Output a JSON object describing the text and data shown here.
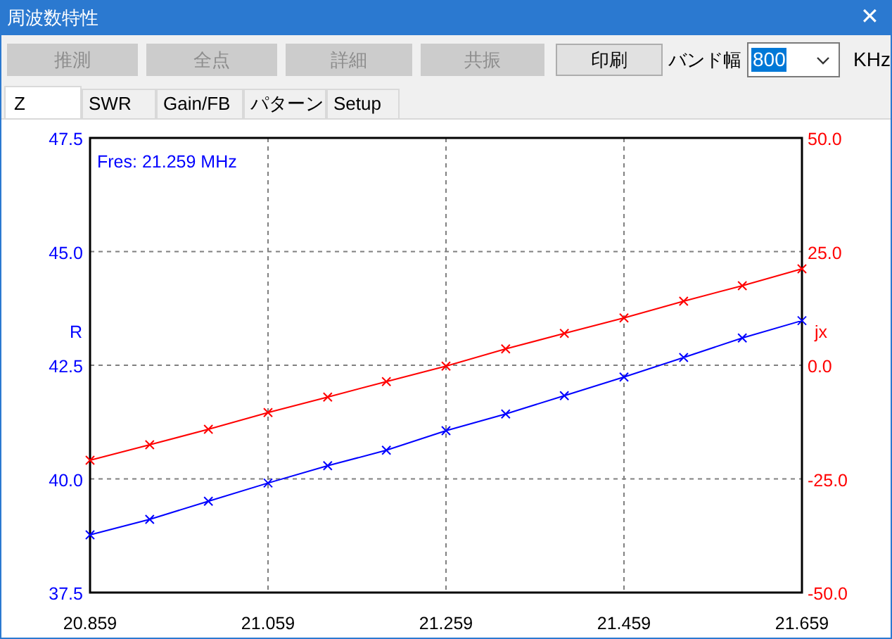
{
  "window": {
    "title": "周波数特性",
    "close": "✕"
  },
  "toolbar": {
    "buttons": [
      {
        "label": "推測",
        "disabled": true
      },
      {
        "label": "全点",
        "disabled": true
      },
      {
        "label": "詳細",
        "disabled": true
      },
      {
        "label": "共振",
        "disabled": true
      },
      {
        "label": "印刷",
        "disabled": false
      }
    ],
    "bandwidth": {
      "label": "バンド幅",
      "value": "800",
      "unit": "KHz"
    }
  },
  "tabs": [
    {
      "label": "Z",
      "selected": true
    },
    {
      "label": "SWR",
      "selected": false
    },
    {
      "label": "Gain/FB",
      "selected": false
    },
    {
      "label": "パターン",
      "selected": false
    },
    {
      "label": "Setup",
      "selected": false
    }
  ],
  "chart": {
    "chart_data": {
      "type": "line",
      "grid": true,
      "xlim": [
        20.859,
        21.659
      ],
      "ylim": [
        37.5,
        47.5
      ],
      "y2lim": [
        -50,
        50
      ],
      "xticks": [
        {
          "value": 20.859,
          "label": "20.859"
        },
        {
          "value": 21.059,
          "label": "21.059"
        },
        {
          "value": 21.259,
          "label": "21.259"
        },
        {
          "value": 21.459,
          "label": "21.459"
        },
        {
          "value": 21.659,
          "label": "21.659"
        }
      ],
      "yticks": [
        {
          "value": 37.5,
          "label": "37.5"
        },
        {
          "value": 40,
          "label": "40.0"
        },
        {
          "value": 42.5,
          "label": "42.5"
        },
        {
          "value": 45,
          "label": "45.0"
        },
        {
          "value": 47.5,
          "label": "47.5"
        }
      ],
      "y2ticks": [
        {
          "value": -50,
          "label": "-50.0"
        },
        {
          "value": -25,
          "label": "-25.0"
        },
        {
          "value": 0,
          "label": "0.0"
        },
        {
          "value": 25,
          "label": "25.0"
        },
        {
          "value": 50,
          "label": "50.0"
        }
      ],
      "x": [
        20.859,
        20.926,
        20.992,
        21.059,
        21.126,
        21.192,
        21.259,
        21.326,
        21.392,
        21.459,
        21.526,
        21.592,
        21.659
      ],
      "series": [
        {
          "name": "R",
          "color": "#0000ff",
          "marker": "x",
          "values": [
            38.77,
            39.11,
            39.51,
            39.91,
            40.29,
            40.63,
            41.06,
            41.43,
            41.83,
            42.24,
            42.67,
            43.1,
            43.48
          ]
        },
        {
          "name": "jx",
          "color": "#ff0000",
          "axis": "y2",
          "marker": "x",
          "values": [
            -20.9,
            -17.5,
            -14.1,
            -10.4,
            -7.0,
            -3.6,
            -0.2,
            3.6,
            7.0,
            10.4,
            14.1,
            17.5,
            21.2
          ]
        }
      ],
      "annotations": [
        "Fres: 21.259 MHz"
      ]
    }
  }
}
